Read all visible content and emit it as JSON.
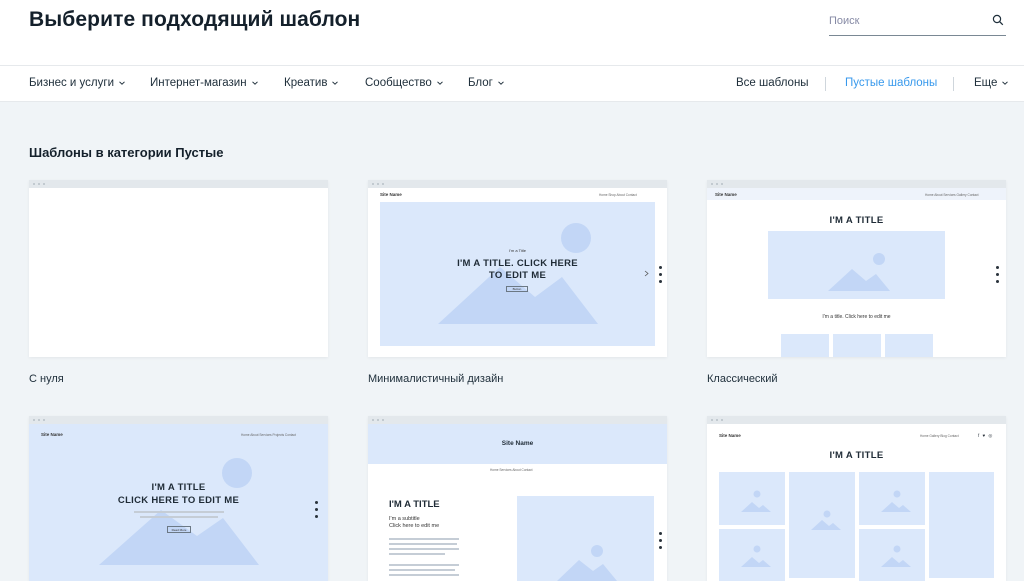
{
  "header": {
    "title": "Выберите подходящий шаблон",
    "search_placeholder": "Поиск"
  },
  "nav": {
    "categories": [
      "Бизнес и услуги",
      "Интернет-магазин",
      "Креатив",
      "Сообщество",
      "Блог"
    ],
    "all_templates": "Все шаблоны",
    "blank_templates": "Пустые шаблоны",
    "more": "Еще"
  },
  "colors": {
    "accent": "#3899ec",
    "preview_blue": "#dbe8fb",
    "shape_blue": "#c2d6f6"
  },
  "section": {
    "title": "Шаблоны в категории Пустые"
  },
  "templates": [
    {
      "label": "С нуля"
    },
    {
      "label": "Минималистичный дизайн",
      "site_name": "Site Name",
      "menu": "Home   Shop   About   Contact",
      "kicker": "I'm a Title",
      "title_line1": "I'M A TITLE. CLICK HERE",
      "title_line2": "TO EDIT ME",
      "button": "Button"
    },
    {
      "label": "Классический",
      "site_name": "Site Name",
      "menu": "Home   About   Services   Gallery   Contact",
      "title": "I'M A TITLE",
      "caption": "I'm a title. Click here to edit me"
    },
    {
      "site_name": "Site Name",
      "menu": "Home   About   Services   Projects   Contact",
      "title_line1": "I'M A TITLE",
      "title_line2": "CLICK HERE TO EDIT ME",
      "button": "Read More"
    },
    {
      "site_name": "Site Name",
      "menu": "Home   Services   About   Contact",
      "title": "I'M A TITLE",
      "subtitle_line1": "I'm a subtitle",
      "subtitle_line2": "Click here to edit me"
    },
    {
      "site_name": "Site Name",
      "menu": "Home   Gallery   Blog   Contact",
      "title": "I'M A TITLE"
    }
  ]
}
